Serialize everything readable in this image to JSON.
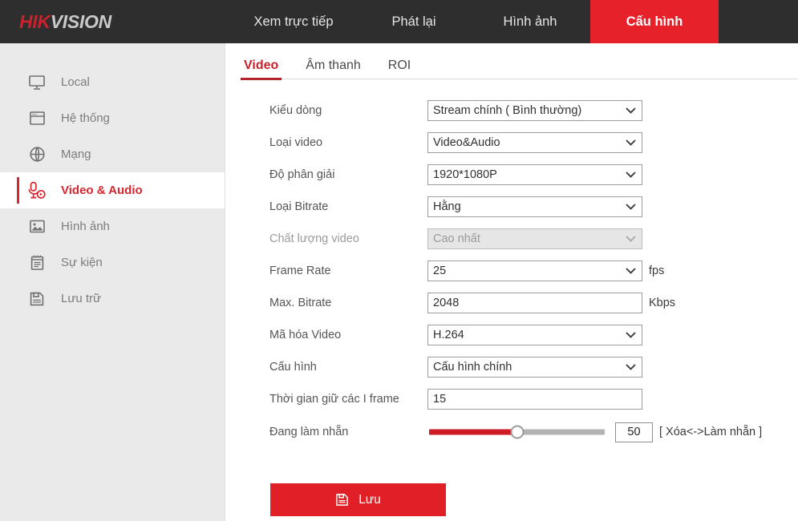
{
  "header": {
    "logo_hik": "HIK",
    "logo_vision": "VISION",
    "nav": [
      {
        "label": "Xem trực tiếp",
        "name": "nav-live-view",
        "active": false
      },
      {
        "label": "Phát lại",
        "name": "nav-playback",
        "active": false
      },
      {
        "label": "Hình ảnh",
        "name": "nav-picture",
        "active": false
      },
      {
        "label": "Cấu hình",
        "name": "nav-configuration",
        "active": true
      }
    ]
  },
  "sidebar": {
    "items": [
      {
        "label": "Local",
        "icon": "monitor-icon",
        "active": false
      },
      {
        "label": "Hệ thống",
        "icon": "window-icon",
        "active": false
      },
      {
        "label": "Mạng",
        "icon": "globe-icon",
        "active": false
      },
      {
        "label": "Video & Audio",
        "icon": "video-audio-icon",
        "active": true
      },
      {
        "label": "Hình ảnh",
        "icon": "picture-icon",
        "active": false
      },
      {
        "label": "Sự kiện",
        "icon": "notepad-icon",
        "active": false
      },
      {
        "label": "Lưu trữ",
        "icon": "floppy-disk-icon",
        "active": false
      }
    ]
  },
  "tabs": [
    {
      "label": "Video",
      "active": true
    },
    {
      "label": "Âm thanh",
      "active": false
    },
    {
      "label": "ROI",
      "active": false
    }
  ],
  "form": {
    "stream_type": {
      "label": "Kiểu dòng",
      "value": "Stream chính ( Bình thường)"
    },
    "video_type": {
      "label": "Loại video",
      "value": "Video&Audio"
    },
    "resolution": {
      "label": "Độ phân giải",
      "value": "1920*1080P"
    },
    "bitrate_type": {
      "label": "Loại Bitrate",
      "value": "Hằng"
    },
    "video_quality": {
      "label": "Chất lượng video",
      "value": "Cao nhất"
    },
    "frame_rate": {
      "label": "Frame Rate",
      "value": "25",
      "unit": "fps"
    },
    "max_bitrate": {
      "label": "Max. Bitrate",
      "value": "2048",
      "unit": "Kbps"
    },
    "video_encoding": {
      "label": "Mã hóa Video",
      "value": "H.264"
    },
    "profile": {
      "label": "Cấu hình",
      "value": "Cấu hình chính"
    },
    "i_frame_interval": {
      "label": "Thời gian giữ các I frame",
      "value": "15"
    },
    "smoothing": {
      "label": "Đang làm nhẵn",
      "value": "50",
      "percent": 50,
      "note": "[ Xóa<->Làm nhẵn ]"
    }
  },
  "actions": {
    "save_label": "Lưu"
  },
  "colors": {
    "brand_red": "#e62129",
    "header_dark": "#2e2e2e",
    "sidebar_bg": "#eaeaea",
    "accent_red": "#d8262f",
    "slider_fill": "#cf1b26"
  }
}
